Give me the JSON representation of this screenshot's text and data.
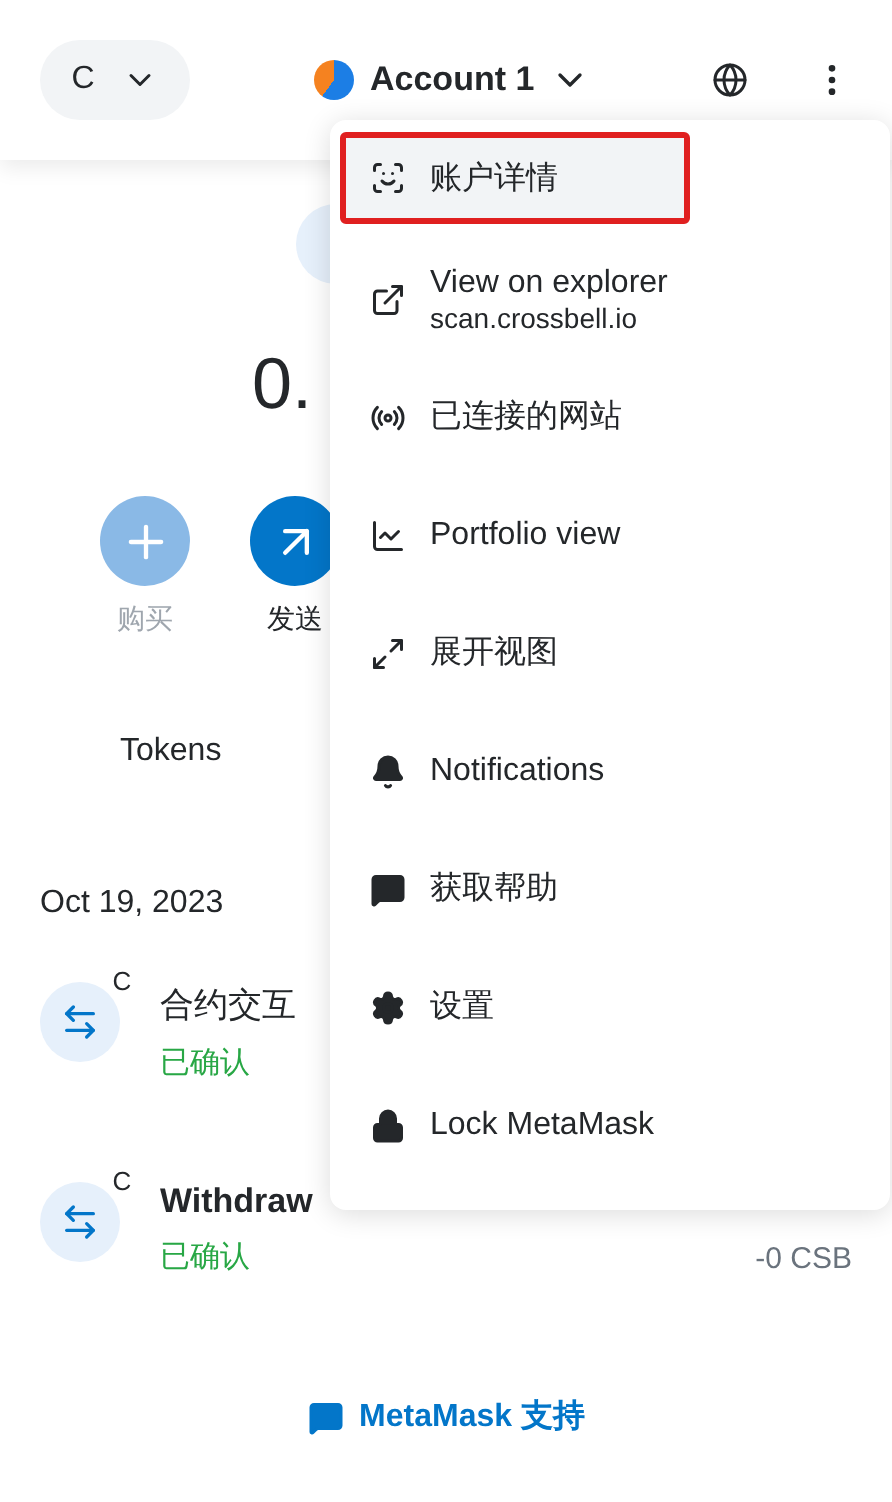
{
  "header": {
    "network": "C",
    "account": "Account 1"
  },
  "balance": "0.",
  "actions": [
    {
      "label": "购买",
      "kind": "buy",
      "disabled": true
    },
    {
      "label": "发送",
      "kind": "send",
      "disabled": false
    }
  ],
  "tabs": [
    {
      "label": "Tokens",
      "selected": false
    }
  ],
  "activity": {
    "date": "Oct 19, 2023",
    "items": [
      {
        "title": "合约交互",
        "status": "已确认",
        "badge": "C"
      },
      {
        "title": "Withdraw",
        "status": "已确认",
        "badge": "C",
        "amount": "-0 CSB"
      }
    ]
  },
  "support_link": "MetaMask 支持",
  "menu": [
    {
      "kind": "details",
      "label": "账户详情",
      "selected": true
    },
    {
      "kind": "explorer",
      "label": "View on explorer",
      "sublabel": "scan.crossbell.io",
      "selected": false
    },
    {
      "kind": "connected",
      "label": "已连接的网站",
      "selected": false
    },
    {
      "kind": "portfolio",
      "label": "Portfolio view",
      "selected": false
    },
    {
      "kind": "expand",
      "label": "展开视图",
      "selected": false
    },
    {
      "kind": "notifications",
      "label": "Notifications",
      "selected": false
    },
    {
      "kind": "help",
      "label": "获取帮助",
      "selected": false
    },
    {
      "kind": "settings",
      "label": "设置",
      "selected": false
    },
    {
      "kind": "lock",
      "label": "Lock MetaMask",
      "selected": false
    }
  ]
}
